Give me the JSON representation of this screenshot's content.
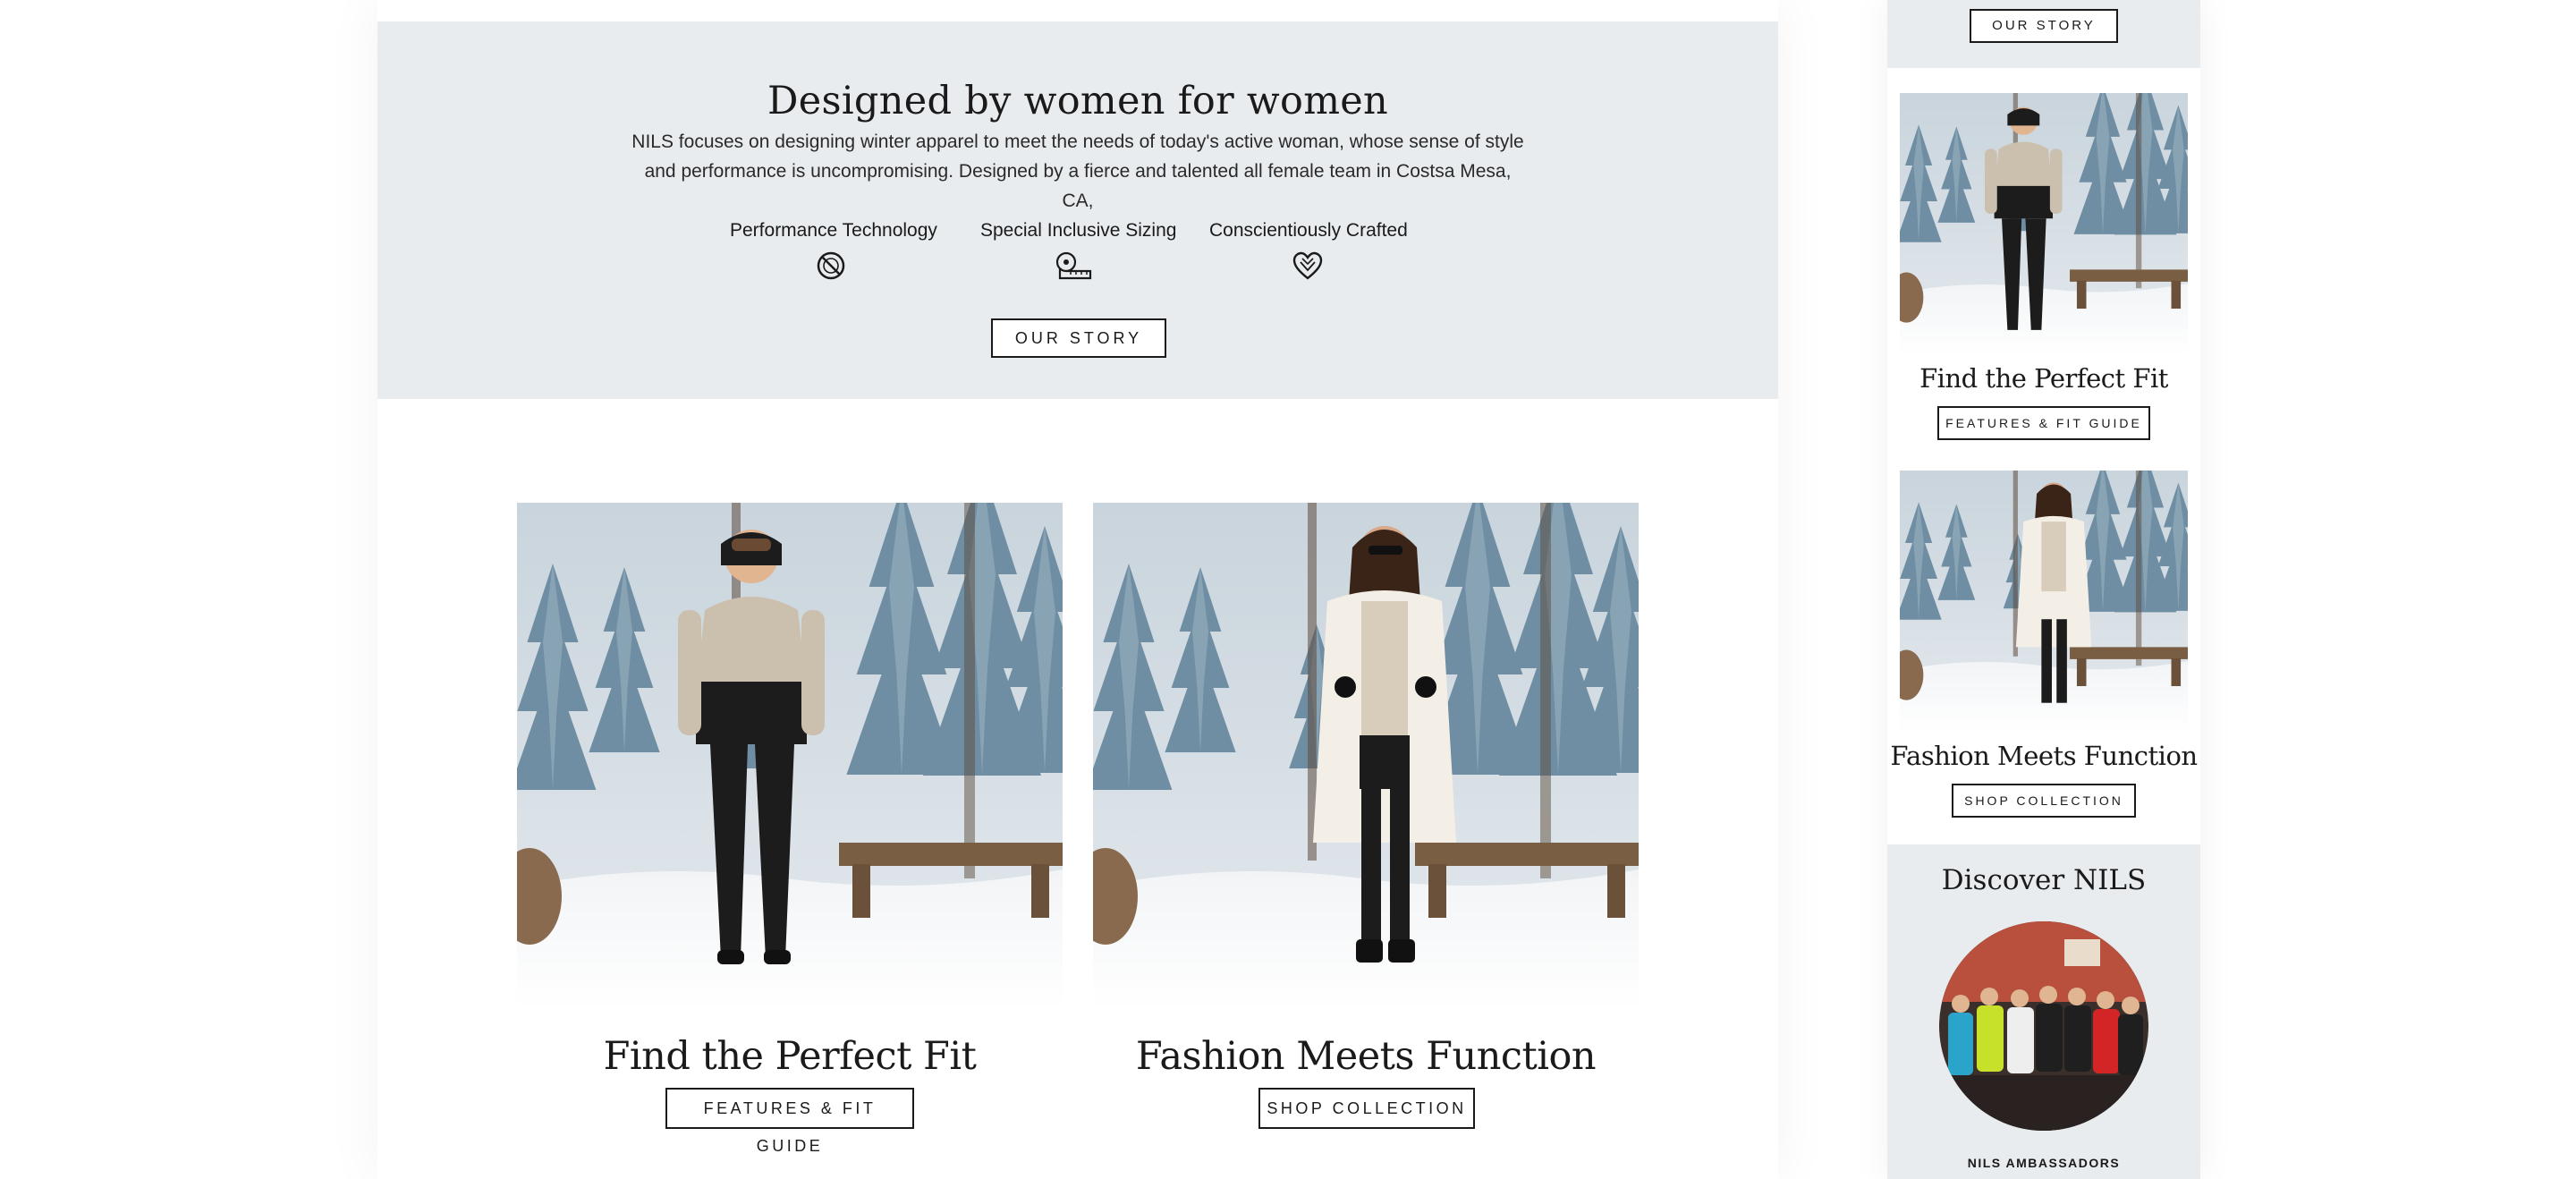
{
  "desktop": {
    "story": {
      "heading": "Designed by women for women",
      "description": "NILS focuses on designing winter apparel to meet the needs of today's active woman, whose sense of style and performance is uncompromising. Designed by a fierce and talented all female team in Costsa Mesa, CA,",
      "features": [
        {
          "label": "Performance Technology",
          "icon": "no-symbol-icon"
        },
        {
          "label": "Special Inclusive Sizing",
          "icon": "measuring-tape-icon"
        },
        {
          "label": "Conscientiously Crafted",
          "icon": "heart-icon"
        }
      ],
      "cta": "OUR STORY"
    },
    "cards": [
      {
        "title": "Find the Perfect Fit",
        "cta": "FEATURES & FIT GUIDE",
        "image": "woman in beige and black ski jacket, snowy forest with wooden bench"
      },
      {
        "title": "Fashion Meets Function",
        "cta": "SHOP COLLECTION",
        "image": "woman in white faux-fur coat, snowy forest with wooden bench"
      }
    ]
  },
  "mobile": {
    "top_cta": "OUR STORY",
    "cards": [
      {
        "title": "Find the Perfect Fit",
        "cta": "FEATURES & FIT GUIDE"
      },
      {
        "title": "Fashion Meets Function",
        "cta": "SHOP COLLECTION"
      }
    ],
    "discover": {
      "heading": "Discover NILS",
      "caption": "NILS AMBASSADORS"
    }
  },
  "colors": {
    "band": "#e8ecef",
    "text": "#1a1a1a",
    "button_border": "#1a1a1a"
  }
}
